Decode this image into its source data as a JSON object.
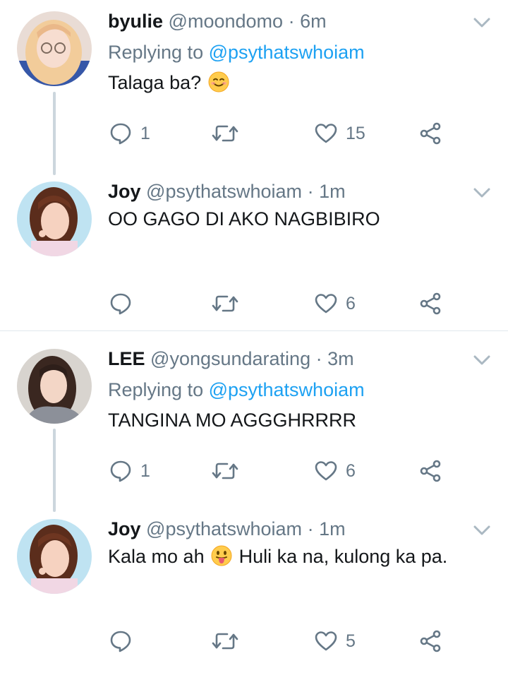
{
  "tweets": [
    {
      "name": "byulie",
      "handle": "@moondomo",
      "separator": "·",
      "time": "6m",
      "replying_prefix": "Replying to ",
      "replying_to": "@psythatswhoiam",
      "text_parts": [
        "Talaga ba?"
      ],
      "emoji": "smiling-face-emoji",
      "reply_count": "1",
      "like_count": "15"
    },
    {
      "name": "Joy",
      "handle": "@psythatswhoiam",
      "separator": "·",
      "time": "1m",
      "text": "OO GAGO DI AKO NAGBIBIRO",
      "like_count": "6"
    },
    {
      "name": "LEE",
      "handle": "@yongsundarating",
      "separator": "·",
      "time": "3m",
      "replying_prefix": "Replying to ",
      "replying_to": "@psythatswhoiam",
      "text": "TANGINA MO AGGGHRRRR",
      "reply_count": "1",
      "like_count": "6"
    },
    {
      "name": "Joy",
      "handle": "@psythatswhoiam",
      "separator": "·",
      "time": "1m",
      "text_before_emoji": "Kala mo ah",
      "emoji": "tongue-out-emoji",
      "text_after_emoji": "Huli ka na, kulong ka pa.",
      "like_count": "5"
    }
  ],
  "colors": {
    "accent": "#1da1f2",
    "secondary_text": "#657786",
    "thread_line": "#ccd6dd",
    "divider": "#e1e8ed"
  }
}
